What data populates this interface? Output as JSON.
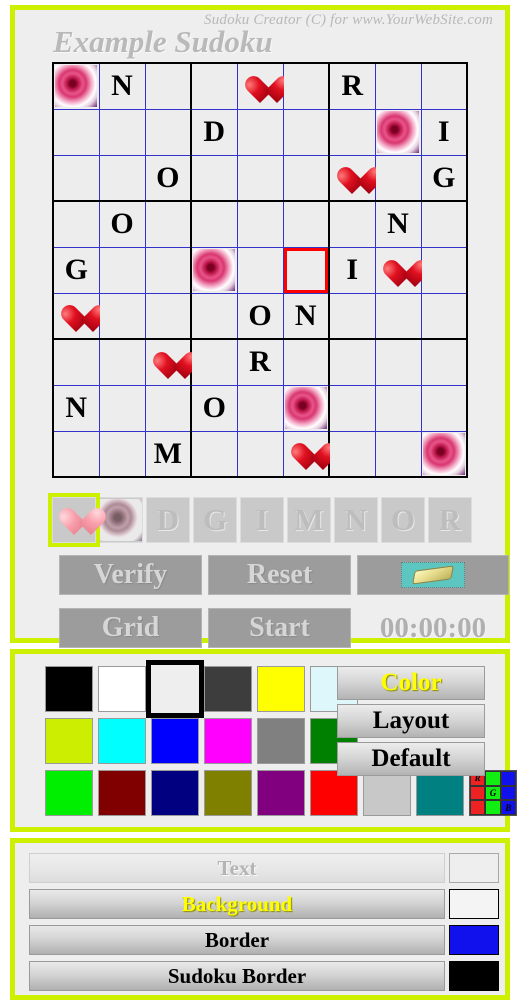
{
  "header": {
    "subtitle": "Sudoku Creator (C) for www.YourWebSite.com",
    "title": "Example Sudoku"
  },
  "theme": {
    "frame": "#ccf000",
    "panel_bg": "#eeeeee",
    "cell_fixed_bg": "#ddf7fb",
    "cell_user_bg": "#ffff00",
    "cell_empty_bg": "#ededed",
    "cell_border": "#3333cc",
    "sudoku_border": "#000000",
    "selection_outline": "#ff0000",
    "accent_text": "#ffff00"
  },
  "grid": {
    "size": 9,
    "selected_cell": {
      "row": 5,
      "col": 6
    },
    "highlighted_cell": {
      "row": 9,
      "col": 9
    },
    "cells": [
      [
        {
          "glyph": "rose",
          "state": "fixed"
        },
        {
          "glyph": "N",
          "state": "fixed"
        },
        {
          "glyph": "",
          "state": "empty"
        },
        {
          "glyph": "",
          "state": "empty"
        },
        {
          "glyph": "heart",
          "state": "fixed"
        },
        {
          "glyph": "",
          "state": "empty"
        },
        {
          "glyph": "R",
          "state": "fixed"
        },
        {
          "glyph": "",
          "state": "empty"
        },
        {
          "glyph": "",
          "state": "empty"
        }
      ],
      [
        {
          "glyph": "",
          "state": "empty"
        },
        {
          "glyph": "",
          "state": "empty"
        },
        {
          "glyph": "",
          "state": "empty"
        },
        {
          "glyph": "D",
          "state": "user"
        },
        {
          "glyph": "",
          "state": "empty"
        },
        {
          "glyph": "",
          "state": "empty"
        },
        {
          "glyph": "",
          "state": "empty"
        },
        {
          "glyph": "rose",
          "state": "fixed"
        },
        {
          "glyph": "I",
          "state": "fixed"
        }
      ],
      [
        {
          "glyph": "",
          "state": "empty"
        },
        {
          "glyph": "",
          "state": "empty"
        },
        {
          "glyph": "O",
          "state": "user"
        },
        {
          "glyph": "",
          "state": "empty"
        },
        {
          "glyph": "",
          "state": "empty"
        },
        {
          "glyph": "",
          "state": "empty"
        },
        {
          "glyph": "heart",
          "state": "fixed"
        },
        {
          "glyph": "",
          "state": "empty"
        },
        {
          "glyph": "G",
          "state": "user"
        }
      ],
      [
        {
          "glyph": "",
          "state": "empty"
        },
        {
          "glyph": "O",
          "state": "user"
        },
        {
          "glyph": "",
          "state": "empty"
        },
        {
          "glyph": "",
          "state": "empty"
        },
        {
          "glyph": "",
          "state": "empty"
        },
        {
          "glyph": "",
          "state": "empty"
        },
        {
          "glyph": "",
          "state": "empty"
        },
        {
          "glyph": "N",
          "state": "user"
        },
        {
          "glyph": "",
          "state": "empty"
        }
      ],
      [
        {
          "glyph": "G",
          "state": "user"
        },
        {
          "glyph": "",
          "state": "empty"
        },
        {
          "glyph": "",
          "state": "empty"
        },
        {
          "glyph": "rose",
          "state": "fixed"
        },
        {
          "glyph": "",
          "state": "empty"
        },
        {
          "glyph": "",
          "state": "selected"
        },
        {
          "glyph": "I",
          "state": "user"
        },
        {
          "glyph": "heart",
          "state": "fixed"
        },
        {
          "glyph": "",
          "state": "empty"
        }
      ],
      [
        {
          "glyph": "heart",
          "state": "fixed"
        },
        {
          "glyph": "",
          "state": "empty"
        },
        {
          "glyph": "",
          "state": "empty"
        },
        {
          "glyph": "",
          "state": "empty"
        },
        {
          "glyph": "O",
          "state": "fixed"
        },
        {
          "glyph": "N",
          "state": "user"
        },
        {
          "glyph": "",
          "state": "empty"
        },
        {
          "glyph": "",
          "state": "empty"
        },
        {
          "glyph": "",
          "state": "empty"
        }
      ],
      [
        {
          "glyph": "",
          "state": "empty"
        },
        {
          "glyph": "",
          "state": "empty"
        },
        {
          "glyph": "heart",
          "state": "fixed"
        },
        {
          "glyph": "",
          "state": "empty"
        },
        {
          "glyph": "R",
          "state": "user"
        },
        {
          "glyph": "",
          "state": "empty"
        },
        {
          "glyph": "",
          "state": "empty"
        },
        {
          "glyph": "",
          "state": "empty"
        },
        {
          "glyph": "",
          "state": "empty"
        }
      ],
      [
        {
          "glyph": "N",
          "state": "fixed"
        },
        {
          "glyph": "",
          "state": "empty"
        },
        {
          "glyph": "",
          "state": "empty"
        },
        {
          "glyph": "O",
          "state": "user"
        },
        {
          "glyph": "",
          "state": "empty"
        },
        {
          "glyph": "rose",
          "state": "fixed"
        },
        {
          "glyph": "",
          "state": "empty"
        },
        {
          "glyph": "",
          "state": "empty"
        },
        {
          "glyph": "",
          "state": "empty"
        }
      ],
      [
        {
          "glyph": "",
          "state": "empty"
        },
        {
          "glyph": "",
          "state": "empty"
        },
        {
          "glyph": "M",
          "state": "user"
        },
        {
          "glyph": "",
          "state": "empty"
        },
        {
          "glyph": "",
          "state": "empty"
        },
        {
          "glyph": "heart",
          "state": "fixed"
        },
        {
          "glyph": "",
          "state": "empty"
        },
        {
          "glyph": "",
          "state": "empty"
        },
        {
          "glyph": "rose",
          "state": "highlight"
        }
      ]
    ]
  },
  "palette": {
    "selected_index": 0,
    "items": [
      {
        "label": "",
        "icon": "heart-icon",
        "name": "palette-heart"
      },
      {
        "label": "",
        "icon": "rose-icon",
        "name": "palette-rose"
      },
      {
        "label": "D",
        "icon": "",
        "name": "palette-d"
      },
      {
        "label": "G",
        "icon": "",
        "name": "palette-g"
      },
      {
        "label": "I",
        "icon": "",
        "name": "palette-i"
      },
      {
        "label": "M",
        "icon": "",
        "name": "palette-m"
      },
      {
        "label": "N",
        "icon": "",
        "name": "palette-n"
      },
      {
        "label": "O",
        "icon": "",
        "name": "palette-o"
      },
      {
        "label": "R",
        "icon": "",
        "name": "palette-r"
      }
    ]
  },
  "actions": {
    "verify": "Verify",
    "reset": "Reset",
    "eraser_icon": "eraser-icon",
    "grid": "Grid",
    "start": "Start",
    "timer": "00:00:00"
  },
  "colors_panel": {
    "buttons": [
      {
        "label": "Color",
        "accent": true
      },
      {
        "label": "Layout",
        "accent": false
      },
      {
        "label": "Default",
        "accent": false
      }
    ],
    "selected_swatch": {
      "row": 0,
      "col": 2
    },
    "swatch_rows": [
      [
        "#000000",
        "#ffffff",
        "#eeeeee",
        "#3d3d3d",
        "#ffff00",
        "#ddf7fb"
      ],
      [
        "#ccee00",
        "#00ffff",
        "#0000ff",
        "#ff00ff",
        "#808080",
        "#008000"
      ],
      [
        "#00ee00",
        "#800000",
        "#000080",
        "#808000",
        "#800080",
        "#ff0000",
        "#c8c8c8",
        "#008080",
        "rgb-picker"
      ]
    ],
    "rgb_picker_labels": [
      "R",
      "G",
      "B"
    ]
  },
  "properties": {
    "rows": [
      {
        "label": "Text",
        "swatch": "#eeeeee",
        "state": "disabled"
      },
      {
        "label": "Background",
        "swatch": "#f4f4f4",
        "state": "accent"
      },
      {
        "label": "Border",
        "swatch": "#1111ee",
        "state": "normal"
      },
      {
        "label": "Sudoku Border",
        "swatch": "#000000",
        "state": "normal"
      }
    ]
  }
}
